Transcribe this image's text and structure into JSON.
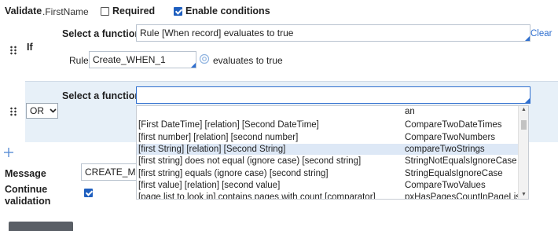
{
  "header": {
    "validate_label": "Validate",
    "property": ".FirstName",
    "required_label": "Required",
    "required_checked": false,
    "enable_conditions_label": "Enable conditions",
    "enable_conditions_checked": true
  },
  "if_row": {
    "label": "If",
    "select_function_label": "Select a function",
    "function_value": "Rule [When record] evaluates to true",
    "clear_label": "Clear",
    "rule_label": "Rule",
    "rule_value": "Create_WHEN_1",
    "evaluates_text": "evaluates to true"
  },
  "or_row": {
    "connector": "OR",
    "select_function_label": "Select a function",
    "function_value": ""
  },
  "dropdown": {
    "options": [
      {
        "label": "",
        "value": "an"
      },
      {
        "label": "[First DateTime] [relation] [Second DateTime]",
        "value": "CompareTwoDateTimes"
      },
      {
        "label": "[first number] [relation] [second number]",
        "value": "CompareTwoNumbers"
      },
      {
        "label": "[first String] [relation] [Second String]",
        "value": "compareTwoStrings",
        "selected": true
      },
      {
        "label": "[first string] does not equal (ignore case) [second string]",
        "value": "StringNotEqualsIgnoreCase"
      },
      {
        "label": "[first string] equals (ignore case) [second string]",
        "value": "StringEqualsIgnoreCase"
      },
      {
        "label": "[first value] [relation] [second value]",
        "value": "CompareTwoValues"
      },
      {
        "label": "[page list to look in] contains pages with count [comparator]",
        "value": "pxHasPagesCountInPageLis"
      }
    ]
  },
  "message": {
    "label": "Message",
    "value": "CREATE_MES"
  },
  "continue_validation": {
    "label_line1": "Continue",
    "label_line2": "validation",
    "checked": true
  },
  "colors": {
    "accent": "#2f6fcf",
    "band": "#e7f0f8",
    "selected_option": "#dde8f6"
  }
}
